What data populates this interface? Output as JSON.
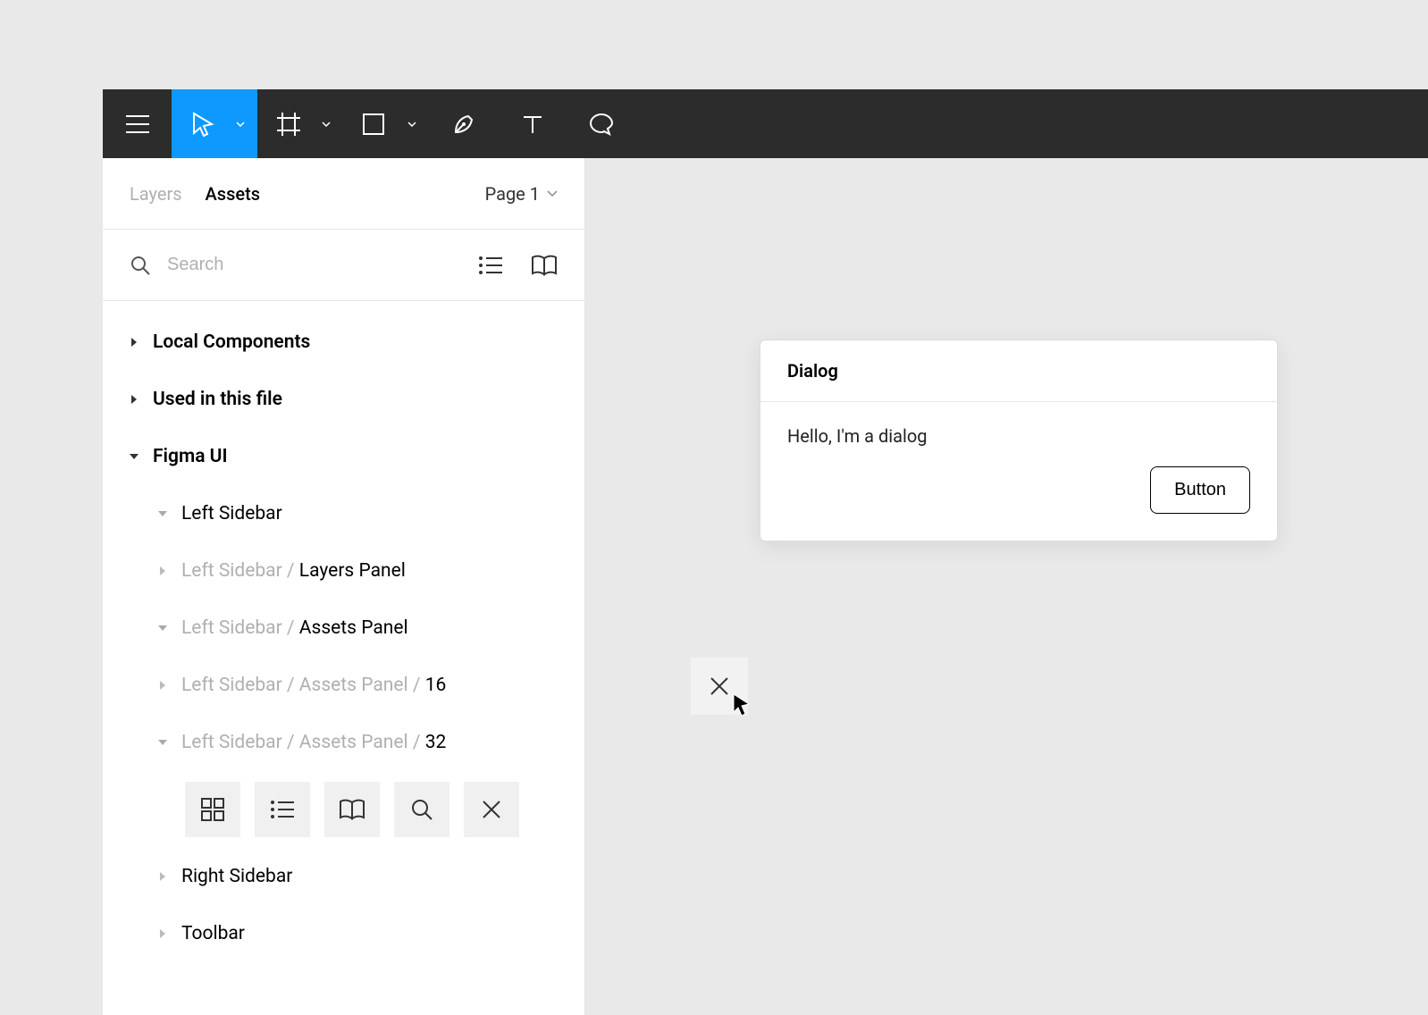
{
  "toolbar": {
    "tools": [
      "menu",
      "move",
      "frame",
      "rectangle",
      "pen",
      "text",
      "comment"
    ]
  },
  "sidebar": {
    "tabs": {
      "layers": "Layers",
      "assets": "Assets",
      "active": "assets"
    },
    "page_selector": "Page 1",
    "search": {
      "placeholder": "Search"
    },
    "tree": {
      "local_components": "Local Components",
      "used_in_file": "Used in this file",
      "figma_ui": "Figma UI",
      "left_sidebar": "Left Sidebar",
      "layers_panel": {
        "prefix": "Left Sidebar / ",
        "name": "Layers Panel"
      },
      "assets_panel": {
        "prefix": "Left Sidebar / ",
        "name": "Assets Panel"
      },
      "assets_16": {
        "prefix": "Left Sidebar / Assets Panel / ",
        "name": "16"
      },
      "assets_32": {
        "prefix": "Left Sidebar / Assets Panel / ",
        "name": "32"
      },
      "right_sidebar": "Right Sidebar",
      "toolbar": "Toolbar"
    },
    "asset_icons_32": [
      "grid",
      "list",
      "book",
      "search",
      "close"
    ]
  },
  "canvas": {
    "dialog": {
      "title": "Dialog",
      "body": "Hello, I'm a dialog",
      "button": "Button"
    }
  }
}
